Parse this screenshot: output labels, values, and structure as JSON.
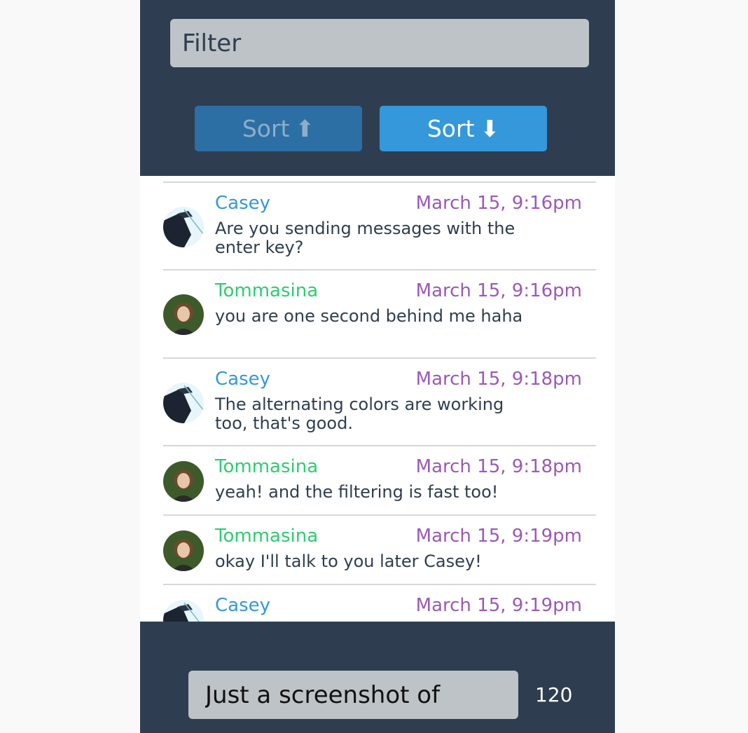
{
  "filter": {
    "placeholder": "Filter"
  },
  "sort": {
    "asc_label": "Sort",
    "asc_arrow": "⬆",
    "desc_label": "Sort",
    "desc_arrow": "⬇",
    "active": "desc"
  },
  "colors": {
    "header_bg": "#2e3e50",
    "casey": "#3498db",
    "tommasina": "#2ecc71",
    "timestamp": "#9b59b6",
    "sort_active": "#3498db",
    "sort_inactive": "#2c6fa5"
  },
  "messages": [
    {
      "author": "Casey",
      "time": "March 15, 9:16pm",
      "text": "Are you sending messages with the enter key?",
      "avatar": "casey-avatar"
    },
    {
      "author": "Tommasina",
      "time": "March 15, 9:16pm",
      "text": "you are one second behind me haha",
      "avatar": "tommasina-avatar"
    },
    {
      "author": "Casey",
      "time": "March 15, 9:18pm",
      "text": "The alternating colors are working too, that's good.",
      "avatar": "casey-avatar"
    },
    {
      "author": "Tommasina",
      "time": "March 15, 9:18pm",
      "text": "yeah! and the filtering is fast too!",
      "avatar": "tommasina-avatar"
    },
    {
      "author": "Tommasina",
      "time": "March 15, 9:19pm",
      "text": "okay I'll talk to you later Casey!",
      "avatar": "tommasina-avatar"
    },
    {
      "author": "Casey",
      "time": "March 15, 9:19pm",
      "text": "",
      "avatar": "casey-avatar"
    }
  ],
  "compose": {
    "value": "Just a screenshot of",
    "char_count": "120"
  }
}
